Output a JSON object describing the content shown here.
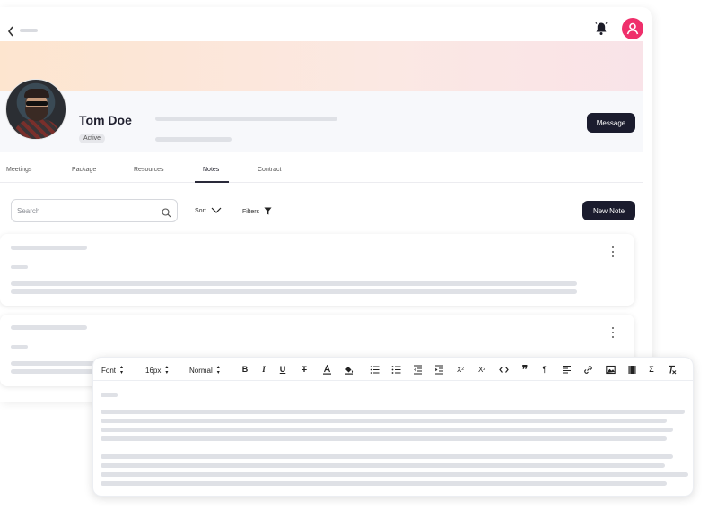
{
  "profile": {
    "name": "Tom Doe",
    "status": "Active",
    "message_label": "Message"
  },
  "tabs": [
    {
      "label": "Meetings",
      "active": false
    },
    {
      "label": "Package",
      "active": false
    },
    {
      "label": "Resources",
      "active": false
    },
    {
      "label": "Notes",
      "active": true
    },
    {
      "label": "Contract",
      "active": false
    }
  ],
  "toolbar": {
    "search_placeholder": "Search",
    "sort_label": "Sort",
    "filters_label": "Filters",
    "new_note_label": "New Note"
  },
  "editor": {
    "font_select": "Font",
    "size_select": "16px",
    "style_select": "Normal",
    "buttons": [
      "bold-icon",
      "italic-icon",
      "underline-icon",
      "strikethrough-icon",
      "text-color-icon",
      "highlight-icon",
      "numbered-list-icon",
      "bullet-list-icon",
      "outdent-icon",
      "indent-icon",
      "superscript-icon",
      "subscript-icon",
      "code-icon",
      "quote-icon",
      "paragraph-icon",
      "align-icon",
      "link-icon",
      "image-icon",
      "video-icon",
      "formula-icon",
      "clear-format-icon"
    ]
  },
  "colors": {
    "primary_dark": "#1b1c2e",
    "accent_pink": "#ef2f6b",
    "banner_start": "#fde5cf",
    "banner_end": "#f9e3e8"
  }
}
